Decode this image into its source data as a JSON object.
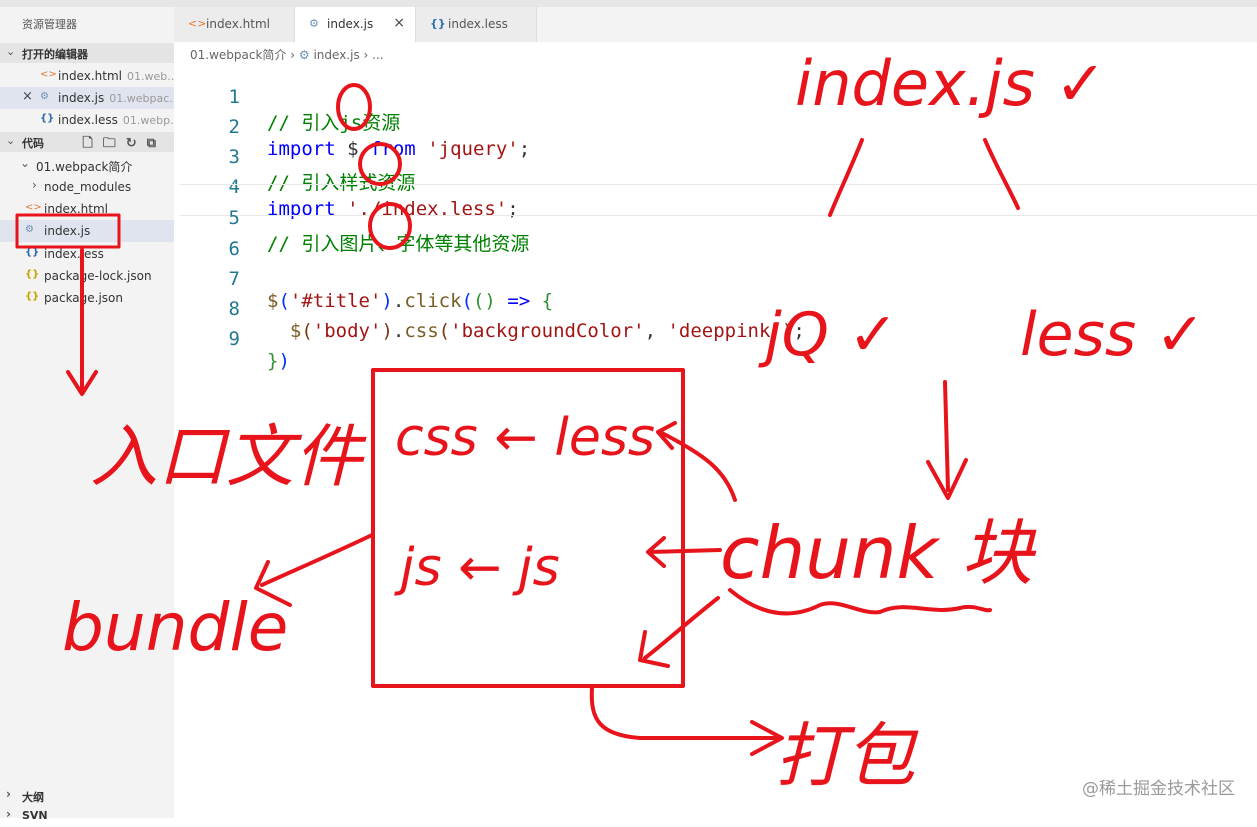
{
  "sidebar": {
    "title": "资源管理器",
    "open_editors_label": "打开的编辑器",
    "open_editors": [
      {
        "name": "index.html",
        "desc": "01.web...",
        "icon": "html-file-icon"
      },
      {
        "name": "index.js",
        "desc": "01.webpac...",
        "icon": "js-file-icon"
      },
      {
        "name": "index.less",
        "desc": "01.webp...",
        "icon": "less-file-icon"
      }
    ],
    "workspace_label": "代码",
    "folder": "01.webpack简介",
    "tree": [
      {
        "name": "node_modules",
        "icon": "chevron-right-icon"
      },
      {
        "name": "index.html",
        "icon": "html-file-icon"
      },
      {
        "name": "index.js",
        "icon": "js-file-icon"
      },
      {
        "name": "index.less",
        "icon": "less-file-icon"
      },
      {
        "name": "package-lock.json",
        "icon": "json-file-icon"
      },
      {
        "name": "package.json",
        "icon": "json-file-icon"
      }
    ],
    "outline_label": "大纲",
    "svn_label": "SVN"
  },
  "tabs": [
    {
      "label": "index.html",
      "icon": "html-file-icon"
    },
    {
      "label": "index.js",
      "icon": "js-file-icon"
    },
    {
      "label": "index.less",
      "icon": "less-file-icon"
    }
  ],
  "breadcrumb": {
    "folder": "01.webpack简介",
    "file": "index.js",
    "more": "..."
  },
  "code": {
    "line_numbers": [
      "1",
      "2",
      "3",
      "4",
      "5",
      "6",
      "7",
      "8",
      "9"
    ],
    "l1": "// 引入js资源",
    "l2_kw": "import",
    "l2_sym": " $ ",
    "l2_from": "from",
    "l2_str": "'jquery'",
    "l2_end": ";",
    "l3": "// 引入样式资源",
    "l4_kw": "import",
    "l4_str": "'./index.less'",
    "l4_end": ";",
    "l5": "// 引入图片、字体等其他资源",
    "l7_fn": "$",
    "l7_p1": "(",
    "l7_str": "'#title'",
    "l7_p2": ")",
    "l7_dot": ".",
    "l7_click": "click",
    "l7_p3": "(",
    "l7_p4": "()",
    "l7_arrow": " => ",
    "l7_brace": "{",
    "l8_fn": "$",
    "l8_p1": "(",
    "l8_str1": "'body'",
    "l8_p2": ")",
    "l8_dot": ".",
    "l8_css": "css",
    "l8_p3": "(",
    "l8_str2": "'backgroundColor'",
    "l8_comma": ", ",
    "l8_str3": "'deeppink'",
    "l8_p4": ")",
    "l8_end": ";",
    "l9_brace": "}",
    "l9_paren": ")"
  },
  "annotations": {
    "index_js": "index.js ✓",
    "jquery": "jQ ✓",
    "less": "less ✓",
    "entry": "入口文件",
    "css_less": "css ← less",
    "js_js": "js ← js",
    "chunk": "chunk 块",
    "bundle": "bundle",
    "pack": "打包"
  },
  "watermark": "@稀土掘金技术社区",
  "colors": {
    "annotation_red": "#e8141b",
    "comment": "#008000",
    "keyword": "#0000ff",
    "string": "#a31515"
  }
}
